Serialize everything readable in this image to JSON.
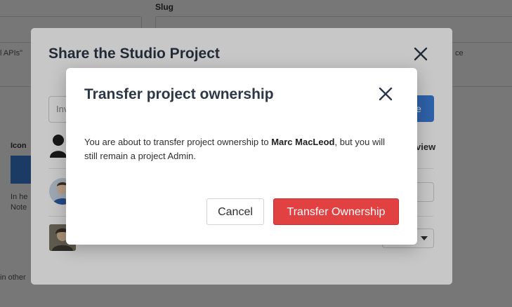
{
  "background": {
    "slug_label": "Slug",
    "left_snippet": "l APIs\"",
    "right_snippet": "ce",
    "icon_label": "Icon",
    "help_text_1": "In he",
    "help_text_2": "Note",
    "bottom_text": "in other"
  },
  "share_modal": {
    "title": "Share the Studio Project",
    "invite_placeholder": "Inv",
    "invite_button": "e",
    "view_header": "view",
    "close_icon": "close-icon",
    "user_icon": "user-group-icon"
  },
  "transfer_dialog": {
    "title": "Transfer project ownership",
    "message_prefix": "You are about to transfer project ownership to ",
    "user_name": "Marc MacLeod",
    "message_suffix": ", but you will still remain a project Admin.",
    "cancel_label": "Cancel",
    "transfer_label": "Transfer Ownership",
    "close_icon": "close-icon"
  },
  "colors": {
    "danger": "#e24141",
    "primary": "#3b7dd8",
    "title": "#2d3748"
  }
}
